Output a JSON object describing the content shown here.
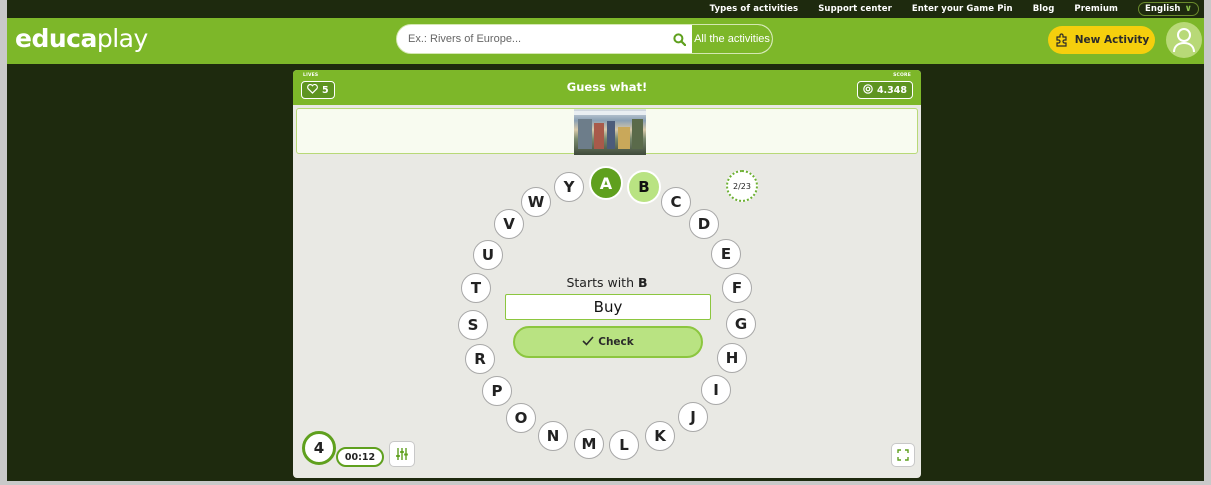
{
  "toplinks": [
    "Types of activities",
    "Support center",
    "Enter your Game Pin",
    "Blog",
    "Premium"
  ],
  "language": "English",
  "logo": {
    "part1": "educa",
    "part2": "play"
  },
  "search": {
    "placeholder": "Ex.: Rivers of Europe...",
    "scope_label": "All the activities"
  },
  "new_activity_label": "New Activity",
  "game": {
    "title": "Guess what!",
    "lives_label": "LIVES",
    "lives": "5",
    "score_label": "SCORE",
    "score": "4.348",
    "progress": "2/23",
    "prompt_prefix": "Starts with",
    "prompt_letter": "B",
    "answer": "Buy",
    "check_label": "Check",
    "round": "4",
    "timer": "00:12",
    "letters": [
      "A",
      "B",
      "C",
      "D",
      "E",
      "F",
      "G",
      "H",
      "I",
      "J",
      "K",
      "L",
      "M",
      "N",
      "O",
      "P",
      "R",
      "S",
      "T",
      "U",
      "V",
      "W",
      "Y"
    ],
    "letter_states": {
      "A": "done",
      "B": "current"
    }
  },
  "colors": {
    "brand_green": "#7db729",
    "dark_green": "#5fa01e",
    "light_green": "#b9e382",
    "accent_yellow": "#f5cf0d",
    "background": "#1e2a0e"
  }
}
